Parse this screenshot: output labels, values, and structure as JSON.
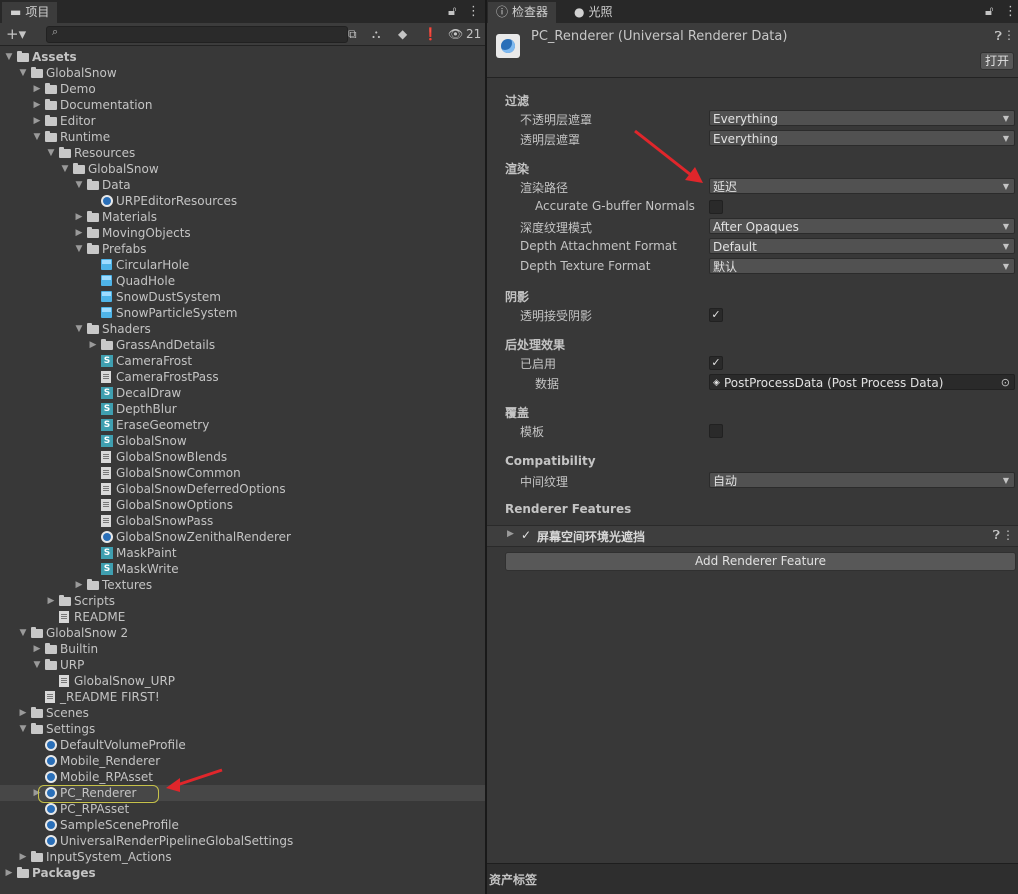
{
  "project": {
    "tab_label": "项目",
    "asset_count": "21",
    "tree": [
      {
        "label": "Assets",
        "depth": 0,
        "arrow": "open",
        "icon": "folder-open",
        "bold": true
      },
      {
        "label": "GlobalSnow",
        "depth": 1,
        "arrow": "open",
        "icon": "folder-open"
      },
      {
        "label": "Demo",
        "depth": 2,
        "arrow": "closed",
        "icon": "folder"
      },
      {
        "label": "Documentation",
        "depth": 2,
        "arrow": "closed",
        "icon": "folder"
      },
      {
        "label": "Editor",
        "depth": 2,
        "arrow": "closed",
        "icon": "folder"
      },
      {
        "label": "Runtime",
        "depth": 2,
        "arrow": "open",
        "icon": "folder-open"
      },
      {
        "label": "Resources",
        "depth": 3,
        "arrow": "open",
        "icon": "folder-open"
      },
      {
        "label": "GlobalSnow",
        "depth": 4,
        "arrow": "open",
        "icon": "folder-open"
      },
      {
        "label": "Data",
        "depth": 5,
        "arrow": "open",
        "icon": "folder-open"
      },
      {
        "label": "URPEditorResources",
        "depth": 6,
        "arrow": "none",
        "icon": "script"
      },
      {
        "label": "Materials",
        "depth": 5,
        "arrow": "closed",
        "icon": "folder"
      },
      {
        "label": "MovingObjects",
        "depth": 5,
        "arrow": "closed",
        "icon": "folder"
      },
      {
        "label": "Prefabs",
        "depth": 5,
        "arrow": "open",
        "icon": "folder-open"
      },
      {
        "label": "CircularHole",
        "depth": 6,
        "arrow": "none",
        "icon": "prefab"
      },
      {
        "label": "QuadHole",
        "depth": 6,
        "arrow": "none",
        "icon": "prefab"
      },
      {
        "label": "SnowDustSystem",
        "depth": 6,
        "arrow": "none",
        "icon": "prefab"
      },
      {
        "label": "SnowParticleSystem",
        "depth": 6,
        "arrow": "none",
        "icon": "prefab"
      },
      {
        "label": "Shaders",
        "depth": 5,
        "arrow": "open",
        "icon": "folder-open"
      },
      {
        "label": "GrassAndDetails",
        "depth": 6,
        "arrow": "closed",
        "icon": "folder"
      },
      {
        "label": "CameraFrost",
        "depth": 6,
        "arrow": "none",
        "icon": "shader"
      },
      {
        "label": "CameraFrostPass",
        "depth": 6,
        "arrow": "none",
        "icon": "doc"
      },
      {
        "label": "DecalDraw",
        "depth": 6,
        "arrow": "none",
        "icon": "shader"
      },
      {
        "label": "DepthBlur",
        "depth": 6,
        "arrow": "none",
        "icon": "shader"
      },
      {
        "label": "EraseGeometry",
        "depth": 6,
        "arrow": "none",
        "icon": "shader"
      },
      {
        "label": "GlobalSnow",
        "depth": 6,
        "arrow": "none",
        "icon": "shader"
      },
      {
        "label": "GlobalSnowBlends",
        "depth": 6,
        "arrow": "none",
        "icon": "doc"
      },
      {
        "label": "GlobalSnowCommon",
        "depth": 6,
        "arrow": "none",
        "icon": "doc"
      },
      {
        "label": "GlobalSnowDeferredOptions",
        "depth": 6,
        "arrow": "none",
        "icon": "doc"
      },
      {
        "label": "GlobalSnowOptions",
        "depth": 6,
        "arrow": "none",
        "icon": "doc"
      },
      {
        "label": "GlobalSnowPass",
        "depth": 6,
        "arrow": "none",
        "icon": "doc"
      },
      {
        "label": "GlobalSnowZenithalRenderer",
        "depth": 6,
        "arrow": "none",
        "icon": "asset"
      },
      {
        "label": "MaskPaint",
        "depth": 6,
        "arrow": "none",
        "icon": "shader"
      },
      {
        "label": "MaskWrite",
        "depth": 6,
        "arrow": "none",
        "icon": "shader"
      },
      {
        "label": "Textures",
        "depth": 5,
        "arrow": "closed",
        "icon": "folder"
      },
      {
        "label": "Scripts",
        "depth": 3,
        "arrow": "closed",
        "icon": "folder"
      },
      {
        "label": "README",
        "depth": 3,
        "arrow": "none",
        "icon": "doc"
      },
      {
        "label": "GlobalSnow 2",
        "depth": 1,
        "arrow": "open",
        "icon": "folder-open"
      },
      {
        "label": "Builtin",
        "depth": 2,
        "arrow": "closed",
        "icon": "folder"
      },
      {
        "label": "URP",
        "depth": 2,
        "arrow": "open",
        "icon": "folder-open"
      },
      {
        "label": "GlobalSnow_URP",
        "depth": 3,
        "arrow": "none",
        "icon": "unity"
      },
      {
        "label": "_README FIRST!",
        "depth": 2,
        "arrow": "none",
        "icon": "doc"
      },
      {
        "label": "Scenes",
        "depth": 1,
        "arrow": "closed",
        "icon": "folder"
      },
      {
        "label": "Settings",
        "depth": 1,
        "arrow": "open",
        "icon": "folder-open"
      },
      {
        "label": "DefaultVolumeProfile",
        "depth": 2,
        "arrow": "none",
        "icon": "asset"
      },
      {
        "label": "Mobile_Renderer",
        "depth": 2,
        "arrow": "none",
        "icon": "asset"
      },
      {
        "label": "Mobile_RPAsset",
        "depth": 2,
        "arrow": "none",
        "icon": "asset"
      },
      {
        "label": "PC_Renderer",
        "depth": 2,
        "arrow": "closed",
        "icon": "asset",
        "selected": true
      },
      {
        "label": "PC_RPAsset",
        "depth": 2,
        "arrow": "none",
        "icon": "asset"
      },
      {
        "label": "SampleSceneProfile",
        "depth": 2,
        "arrow": "none",
        "icon": "asset"
      },
      {
        "label": "UniversalRenderPipelineGlobalSettings",
        "depth": 2,
        "arrow": "none",
        "icon": "asset"
      },
      {
        "label": "InputSystem_Actions",
        "depth": 1,
        "arrow": "closed",
        "icon": "input"
      },
      {
        "label": "Packages",
        "depth": 0,
        "arrow": "closed",
        "icon": "folder",
        "bold": true
      }
    ]
  },
  "inspector": {
    "tab_label": "检查器",
    "lighting_tab_label": "光照",
    "title": "PC_Renderer (Universal Renderer Data)",
    "open_button": "打开",
    "sections": {
      "filter": "过滤",
      "render": "渲染",
      "shadow": "阴影",
      "post": "后处理效果",
      "override": "覆盖",
      "compat": "Compatibility",
      "features": "Renderer Features"
    },
    "props": {
      "opaque_mask": {
        "label": "不透明层遮罩",
        "value": "Everything"
      },
      "transparent_mask": {
        "label": "透明层遮罩",
        "value": "Everything"
      },
      "render_path": {
        "label": "渲染路径",
        "value": "延迟"
      },
      "gbuffer": {
        "label": "Accurate G-buffer Normals",
        "checked": false
      },
      "depth_mode": {
        "label": "深度纹理模式",
        "value": "After Opaques"
      },
      "depth_attach": {
        "label": "Depth Attachment Format",
        "value": "Default"
      },
      "depth_tex": {
        "label": "Depth Texture Format",
        "value": "默认"
      },
      "transparent_shadow": {
        "label": "透明接受阴影",
        "checked": true
      },
      "post_enabled": {
        "label": "已启用",
        "checked": true
      },
      "post_data": {
        "label": "数据",
        "value": "PostProcessData (Post Process Data)"
      },
      "stencil": {
        "label": "模板",
        "checked": false
      },
      "intermediate": {
        "label": "中间纹理",
        "value": "自动"
      }
    },
    "feature_name": "屏幕空间环境光遮挡",
    "add_feature_button": "Add Renderer Feature",
    "footer_label": "资产标签"
  }
}
